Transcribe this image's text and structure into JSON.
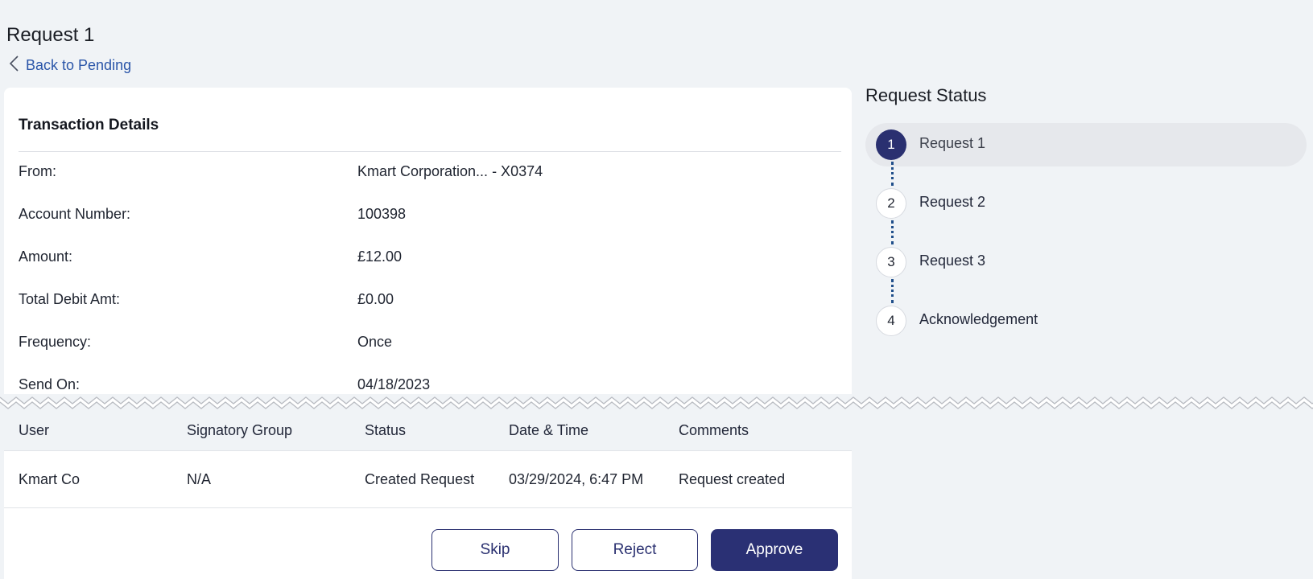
{
  "header": {
    "title": "Request 1",
    "back_label": "Back to Pending"
  },
  "transaction": {
    "section_title": "Transaction Details",
    "rows": [
      {
        "label": "From:",
        "value": "Kmart Corporation... - X0374"
      },
      {
        "label": "Account Number:",
        "value": "100398"
      },
      {
        "label": "Amount:",
        "value": "£12.00"
      },
      {
        "label": "Total Debit Amt:",
        "value": "£0.00"
      },
      {
        "label": "Frequency:",
        "value": "Once"
      },
      {
        "label": "Send On:",
        "value": "04/18/2023"
      }
    ]
  },
  "history": {
    "columns": [
      "User",
      "Signatory Group",
      "Status",
      "Date & Time",
      "Comments"
    ],
    "rows": [
      [
        "Kmart Co",
        "N/A",
        "Created Request",
        "03/29/2024, 6:47 PM",
        "Request created"
      ]
    ]
  },
  "actions": {
    "skip_label": "Skip",
    "reject_label": "Reject",
    "approve_label": "Approve"
  },
  "status_panel": {
    "title": "Request Status",
    "steps": [
      {
        "number": "1",
        "label": "Request 1",
        "state": "active"
      },
      {
        "number": "2",
        "label": "Request 2",
        "state": "pending"
      },
      {
        "number": "3",
        "label": "Request 3",
        "state": "pending"
      },
      {
        "number": "4",
        "label": "Acknowledgement",
        "state": "pending"
      }
    ]
  },
  "colors": {
    "primary": "#2a3074",
    "link": "#2a55a8",
    "page_bg": "#f0f3f6",
    "connector": "#1f4e8a"
  }
}
